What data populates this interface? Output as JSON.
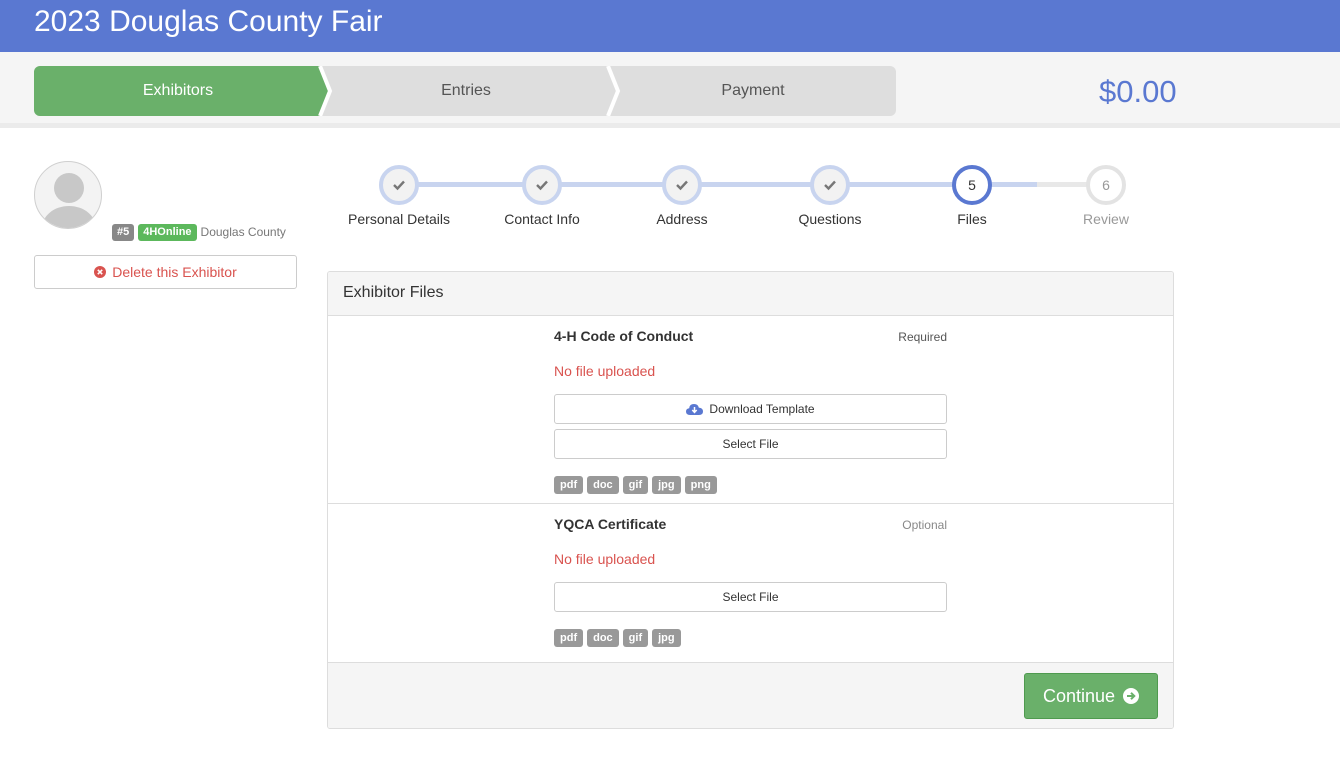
{
  "header": {
    "title": "2023 Douglas County Fair"
  },
  "wizard": {
    "steps": [
      {
        "label": "Exhibitors"
      },
      {
        "label": "Entries"
      },
      {
        "label": "Payment"
      }
    ],
    "active_color": "#6ab06a",
    "inactive_color": "#dedede"
  },
  "cart": {
    "total": "$0.00"
  },
  "exhibitor": {
    "number_badge": "#5",
    "source_badge": "4HOnline",
    "county": "Douglas County",
    "delete_label": "Delete this Exhibitor"
  },
  "progress": {
    "steps": [
      {
        "number": "",
        "label": "Personal Details",
        "state": "complete"
      },
      {
        "number": "",
        "label": "Contact Info",
        "state": "complete"
      },
      {
        "number": "",
        "label": "Address",
        "state": "complete"
      },
      {
        "number": "",
        "label": "Questions",
        "state": "complete"
      },
      {
        "number": "5",
        "label": "Files",
        "state": "current"
      },
      {
        "number": "6",
        "label": "Review",
        "state": "future"
      }
    ]
  },
  "panel": {
    "title": "Exhibitor Files",
    "files": [
      {
        "name": "4-H Code of Conduct",
        "requirement": "Required",
        "status": "No file uploaded",
        "download_label": "Download Template",
        "select_label": "Select File",
        "types": [
          "pdf",
          "doc",
          "gif",
          "jpg",
          "png"
        ]
      },
      {
        "name": "YQCA Certificate",
        "requirement": "Optional",
        "status": "No file uploaded",
        "select_label": "Select File",
        "types": [
          "pdf",
          "doc",
          "gif",
          "jpg"
        ]
      }
    ],
    "continue_label": "Continue"
  },
  "icons": {
    "check": "check-icon",
    "delete": "times-circle-icon",
    "download": "cloud-download-icon",
    "continue": "arrow-circle-right-icon"
  }
}
